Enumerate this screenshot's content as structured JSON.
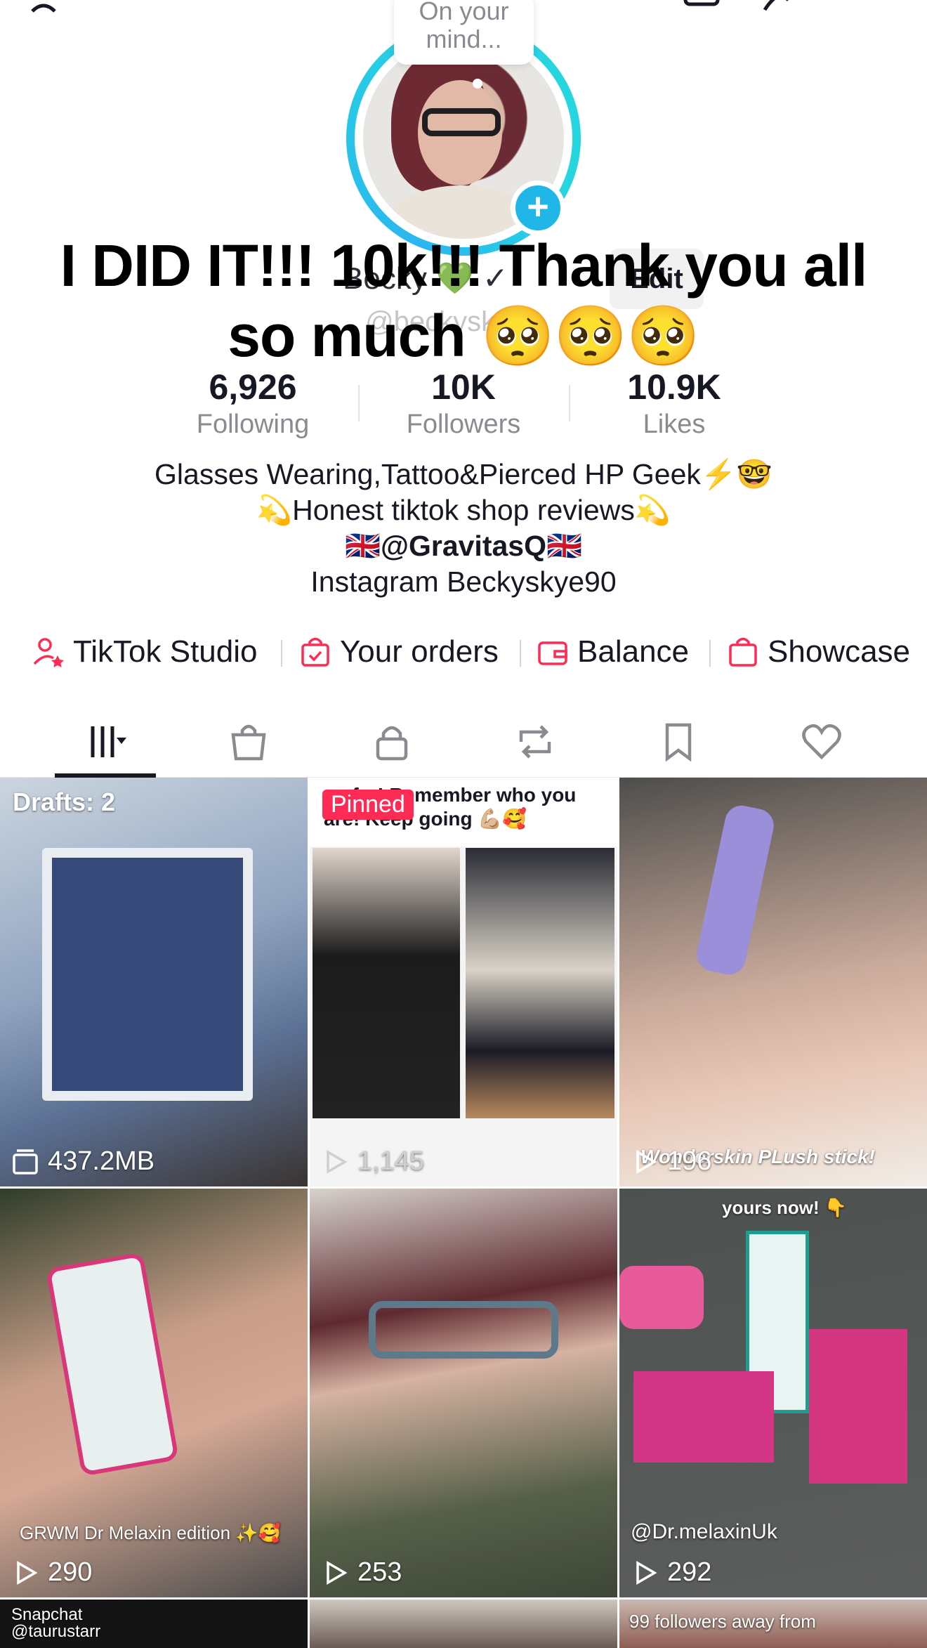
{
  "header": {
    "mind_bubble": [
      "On your",
      "mind..."
    ],
    "display_name": "Becky 💚 ✓",
    "username": "@beckysk...0",
    "edit_label": "Edit",
    "overlay_line1": "I DID IT!!! 10k!!! Thank you all",
    "overlay_line2": "so much 🥺🥺🥺"
  },
  "stats": [
    {
      "value": "6,926",
      "label": "Following"
    },
    {
      "value": "10K",
      "label": "Followers"
    },
    {
      "value": "10.9K",
      "label": "Likes"
    }
  ],
  "bio": [
    "Glasses Wearing,Tattoo&Pierced HP Geek⚡️🤓",
    "💫Honest tiktok shop reviews💫",
    "🇬🇧@GravitasQ🇬🇧",
    "Instagram Beckyskye90"
  ],
  "links": [
    {
      "label": "TikTok Studio",
      "icon": "person-star-icon"
    },
    {
      "label": "Your orders",
      "icon": "shopping-bag-check-icon"
    },
    {
      "label": "Balance",
      "icon": "wallet-icon"
    },
    {
      "label": "Showcase",
      "icon": "shopping-bag-icon"
    }
  ],
  "tabs": [
    {
      "icon": "grid-icon",
      "active": true
    },
    {
      "icon": "shop-bag-icon"
    },
    {
      "icon": "lock-icon"
    },
    {
      "icon": "repost-icon"
    },
    {
      "icon": "bookmark-icon"
    },
    {
      "icon": "heart-icon"
    }
  ],
  "grid": {
    "drafts": {
      "label": "Drafts: 2",
      "size": "437.2MB"
    },
    "pinned": {
      "badge": "Pinned",
      "caption": "so far! Remember who you are! Keep going 💪🏼🥰",
      "views": "1,145"
    },
    "video3": {
      "views": "196",
      "caption": "Wonderskin PLush stick!"
    },
    "video4": {
      "views": "290",
      "caption": "GRWM Dr Melaxin edition ✨🥰"
    },
    "video5": {
      "views": "253"
    },
    "video6": {
      "views": "292",
      "caption_top": "yours now! 👇",
      "caption": "@Dr.melaxinUk"
    },
    "video7": {
      "caption": "Snapchat @taurustarr"
    },
    "video9": {
      "caption": "99 followers away from"
    }
  },
  "colors": {
    "accent": "#fe2c55",
    "ring": "#25d6e0",
    "add_button": "#20b7e8",
    "text": "#161823",
    "muted": "#8a8b91"
  }
}
